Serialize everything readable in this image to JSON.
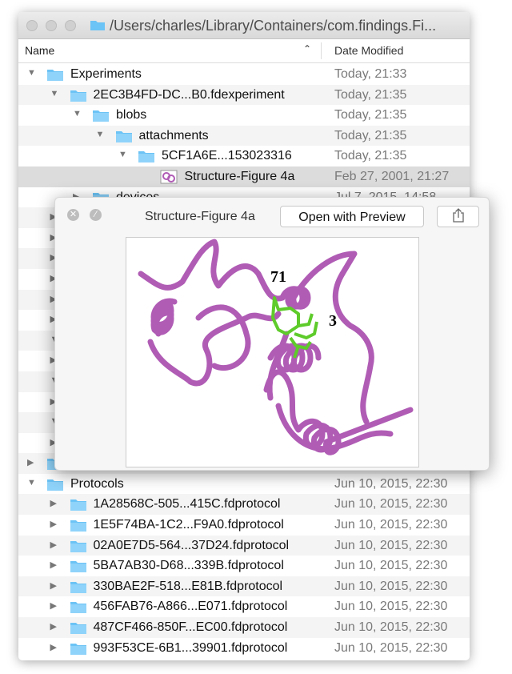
{
  "window": {
    "title": "/Users/charles/Library/Containers/com.findings.Fi..."
  },
  "header": {
    "name": "Name",
    "date_modified": "Date Modified",
    "sort_icon": "chevron-up-icon"
  },
  "rows": [
    {
      "depth": 0,
      "expanded": true,
      "icon": "folder",
      "name": "Experiments",
      "date": "Today, 21:33"
    },
    {
      "depth": 1,
      "expanded": true,
      "icon": "folder",
      "name": "2EC3B4FD-DC...B0.fdexperiment",
      "date": "Today, 21:35"
    },
    {
      "depth": 2,
      "expanded": true,
      "icon": "folder",
      "name": "blobs",
      "date": "Today, 21:35"
    },
    {
      "depth": 3,
      "expanded": true,
      "icon": "folder",
      "name": "attachments",
      "date": "Today, 21:35"
    },
    {
      "depth": 4,
      "expanded": true,
      "icon": "folder",
      "name": "5CF1A6E...153023316",
      "date": "Today, 21:35"
    },
    {
      "depth": 5,
      "expanded": null,
      "icon": "image",
      "name": "Structure-Figure 4a",
      "date": "Feb 27, 2001, 21:27",
      "selected": true
    },
    {
      "depth": 2,
      "expanded": false,
      "icon": "folder",
      "name": "devices",
      "date": "Jul 7, 2015, 14:58"
    },
    {
      "depth": 1,
      "expanded": false,
      "icon": "folder",
      "name": "",
      "date": ""
    },
    {
      "depth": 1,
      "expanded": false,
      "icon": "folder",
      "name": "",
      "date": ""
    },
    {
      "depth": 1,
      "expanded": false,
      "icon": "folder",
      "name": "",
      "date": ""
    },
    {
      "depth": 1,
      "expanded": false,
      "icon": "folder",
      "name": "",
      "date": ""
    },
    {
      "depth": 1,
      "expanded": false,
      "icon": "folder",
      "name": "",
      "date": ""
    },
    {
      "depth": 1,
      "expanded": false,
      "icon": "folder",
      "name": "",
      "date": ""
    },
    {
      "depth": 1,
      "expanded": true,
      "icon": "folder",
      "name": "",
      "date": ""
    },
    {
      "depth": 1,
      "expanded": false,
      "icon": "folder",
      "name": "",
      "date": ""
    },
    {
      "depth": 1,
      "expanded": true,
      "icon": "folder",
      "name": "",
      "date": ""
    },
    {
      "depth": 1,
      "expanded": false,
      "icon": "folder",
      "name": "",
      "date": ""
    },
    {
      "depth": 1,
      "expanded": true,
      "icon": "folder",
      "name": "",
      "date": ""
    },
    {
      "depth": 1,
      "expanded": false,
      "icon": "folder",
      "name": "",
      "date": ""
    },
    {
      "depth": 0,
      "expanded": false,
      "icon": "folder",
      "name": "",
      "date": ""
    },
    {
      "depth": 0,
      "expanded": true,
      "icon": "folder",
      "name": "Protocols",
      "date": "Jun 10, 2015, 22:30"
    },
    {
      "depth": 1,
      "expanded": false,
      "icon": "folder",
      "name": "1A28568C-505...415C.fdprotocol",
      "date": "Jun 10, 2015, 22:30"
    },
    {
      "depth": 1,
      "expanded": false,
      "icon": "folder",
      "name": "1E5F74BA-1C2...F9A0.fdprotocol",
      "date": "Jun 10, 2015, 22:30"
    },
    {
      "depth": 1,
      "expanded": false,
      "icon": "folder",
      "name": "02A0E7D5-564...37D24.fdprotocol",
      "date": "Jun 10, 2015, 22:30"
    },
    {
      "depth": 1,
      "expanded": false,
      "icon": "folder",
      "name": "5BA7AB30-D68...339B.fdprotocol",
      "date": "Jun 10, 2015, 22:30"
    },
    {
      "depth": 1,
      "expanded": false,
      "icon": "folder",
      "name": "330BAE2F-518...E81B.fdprotocol",
      "date": "Jun 10, 2015, 22:30"
    },
    {
      "depth": 1,
      "expanded": false,
      "icon": "folder",
      "name": "456FAB76-A866...E071.fdprotocol",
      "date": "Jun 10, 2015, 22:30"
    },
    {
      "depth": 1,
      "expanded": false,
      "icon": "folder",
      "name": "487CF466-850F...EC00.fdprotocol",
      "date": "Jun 10, 2015, 22:30"
    },
    {
      "depth": 1,
      "expanded": false,
      "icon": "folder",
      "name": "993F53CE-6B1...39901.fdprotocol",
      "date": "Jun 10, 2015, 22:30"
    }
  ],
  "quicklook": {
    "title": "Structure-Figure 4a",
    "open_button": "Open with Preview",
    "share_icon": "share-icon",
    "close_icon": "close-icon",
    "fullscreen_icon": "fullscreen-icon",
    "image_labels": [
      "71",
      "3"
    ]
  },
  "colors": {
    "folder": "#6cc3f5",
    "ribbon": "#b05cb5",
    "residue": "#5ecb2a",
    "selected_row": "#dcdcdc"
  }
}
